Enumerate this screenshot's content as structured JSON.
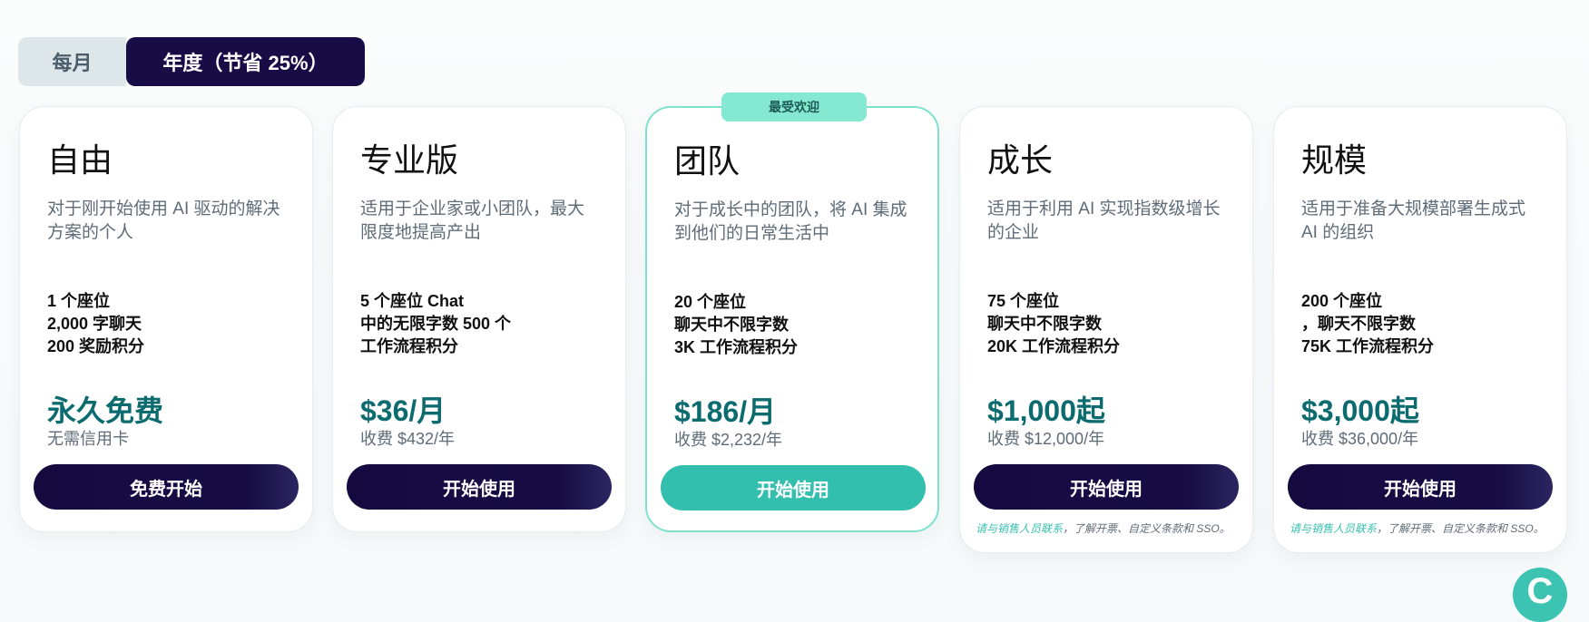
{
  "billing_toggle": {
    "monthly": "每月",
    "annual": "年度（节省 25%）"
  },
  "featured_badge": "最受欢迎",
  "plans": [
    {
      "name": "自由",
      "description": "对于刚开始使用 AI 驱动的解决方案的个人",
      "features": [
        "1 个座位",
        "2,000 字聊天",
        "200 奖励积分"
      ],
      "price": "永久免费",
      "price_sub": "无需信用卡",
      "cta": "免费开始"
    },
    {
      "name": "专业版",
      "description": "适用于企业家或小团队，最大限度地提高产出",
      "features": [
        "5 个座位 Chat",
        "中的无限字数 500 个",
        "工作流程积分"
      ],
      "price": "$36/月",
      "price_sub": "收费 $432/年",
      "cta": "开始使用"
    },
    {
      "name": "团队",
      "description": "对于成长中的团队，将 AI 集成到他们的日常生活中",
      "features": [
        "20 个座位",
        "聊天中不限字数",
        "3K 工作流程积分"
      ],
      "price": "$186/月",
      "price_sub": "收费 $2,232/年",
      "cta": "开始使用"
    },
    {
      "name": "成长",
      "description": "适用于利用 AI 实现指数级增长的企业",
      "features": [
        "75 个座位",
        "聊天中不限字数",
        "20K 工作流程积分"
      ],
      "price": "$1,000起",
      "price_sub": "收费 $12,000/年",
      "cta": "开始使用",
      "footnote_link": "请与销售人员联系",
      "footnote_text": "，了解开票、自定义条款和 SSO。"
    },
    {
      "name": "规模",
      "description": "适用于准备大规模部署生成式 AI 的组织",
      "features": [
        "200 个座位",
        "，聊天不限字数",
        "75K 工作流程积分"
      ],
      "price": "$3,000起",
      "price_sub": "收费 $36,000/年",
      "cta": "开始使用",
      "footnote_link": "请与销售人员联系",
      "footnote_text": "，了解开票、自定义条款和 SSO。"
    }
  ],
  "chat_widget": {
    "glyph": "C"
  },
  "colors": {
    "navy": "#170c45",
    "teal": "#33bfae",
    "price": "#0b6b6f",
    "badge": "#85e9d2"
  }
}
